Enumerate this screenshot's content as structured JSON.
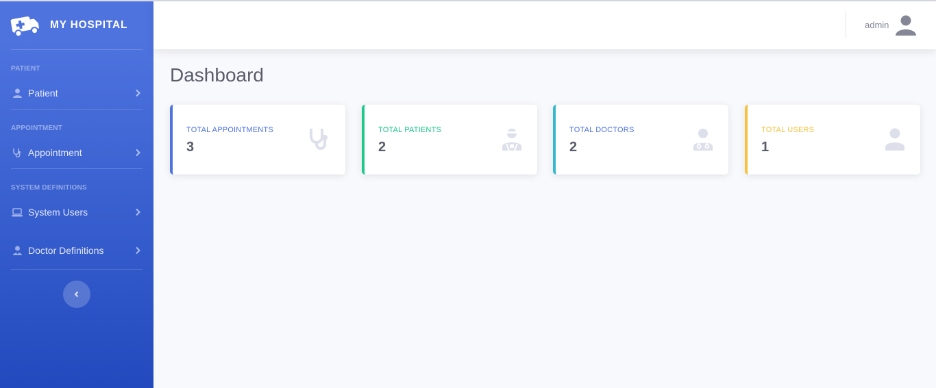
{
  "brand": {
    "title": "MY HOSPITAL",
    "icon": "ambulance-icon"
  },
  "sidebar": {
    "sections": [
      {
        "heading": "PATIENT"
      },
      {
        "heading": "APPOINTMENT"
      },
      {
        "heading": "SYSTEM DEFINITIONS"
      }
    ],
    "items": [
      {
        "label": "Patient",
        "icon": "user-icon"
      },
      {
        "label": "Appointment",
        "icon": "stethoscope-icon"
      },
      {
        "label": "System Users",
        "icon": "laptop-icon"
      },
      {
        "label": "Doctor Definitions",
        "icon": "user-doctor-icon"
      }
    ],
    "toggle_icon": "chevron-left-icon"
  },
  "topbar": {
    "user_name": "admin",
    "avatar_icon": "user-avatar-icon"
  },
  "page": {
    "title": "Dashboard"
  },
  "cards": [
    {
      "label": "TOTAL APPOINTMENTS",
      "value": "3",
      "color": "#4e73df",
      "icon": "stethoscope-icon"
    },
    {
      "label": "TOTAL PATIENTS",
      "value": "2",
      "color": "#1cc88a",
      "icon": "user-injured-icon"
    },
    {
      "label": "TOTAL DOCTORS",
      "value": "2",
      "color": "#36b9cc",
      "icon": "user-doctor-icon"
    },
    {
      "label": "TOTAL USERS",
      "value": "1",
      "color": "#f6c23e",
      "icon": "user-icon"
    }
  ],
  "colors": {
    "sidebar_start": "#4e73df",
    "sidebar_end": "#224abe",
    "background": "#f8f9fc",
    "text_gray": "#5a5c69",
    "icon_gray": "#dddfeb"
  }
}
